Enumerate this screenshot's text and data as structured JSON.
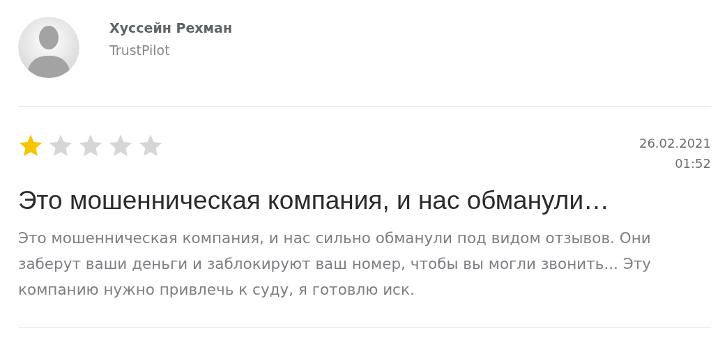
{
  "review": {
    "author": "Хуссейн Рехман",
    "source": "TrustPilot",
    "stars": 1,
    "date": "26.02.2021",
    "time": "01:52",
    "title": "Это мошенническая компания, и нас обманули…",
    "body": "Это мошенническая компания, и нас сильно обманули под видом отзывов. Они заберут ваши деньги и заблокируют ваш номер, чтобы вы могли звонить... Эту компанию нужно привлечь к суду, я готовлю иск."
  }
}
